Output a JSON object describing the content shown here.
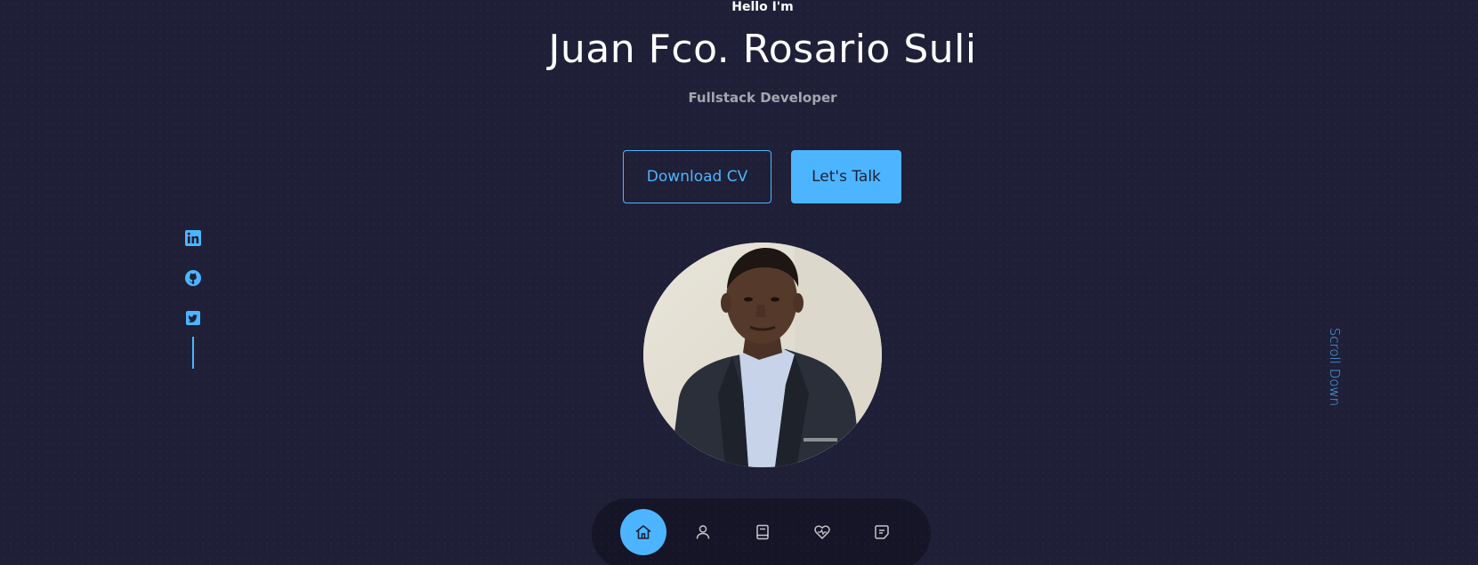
{
  "header": {
    "greeting": "Hello I'm",
    "name": "Juan Fco. Rosario Suli",
    "role": "Fullstack Developer"
  },
  "cta": {
    "download_label": "Download CV",
    "talk_label": "Let's Talk"
  },
  "socials": [
    {
      "icon": "linkedin-icon"
    },
    {
      "icon": "github-icon"
    },
    {
      "icon": "twitter-icon"
    }
  ],
  "scroll": {
    "label": "Scroll Down"
  },
  "nav": {
    "items": [
      {
        "icon": "home-icon",
        "active": true
      },
      {
        "icon": "user-icon",
        "active": false
      },
      {
        "icon": "book-icon",
        "active": false
      },
      {
        "icon": "services-icon",
        "active": false
      },
      {
        "icon": "message-icon",
        "active": false
      }
    ]
  },
  "colors": {
    "background": "#1f1f38",
    "accent": "#4db5ff",
    "text": "#ffffff",
    "muted": "rgba(255,255,255,0.6)"
  }
}
